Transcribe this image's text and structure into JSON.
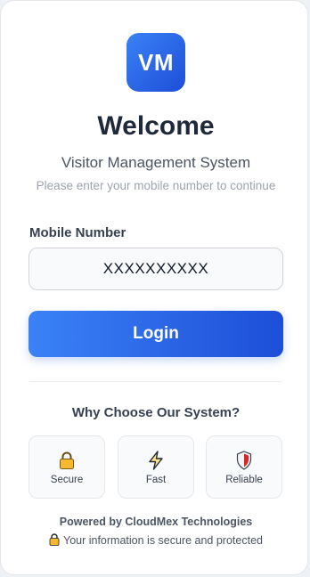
{
  "logo": {
    "text": "VM"
  },
  "header": {
    "title": "Welcome",
    "subtitle": "Visitor Management System",
    "hint": "Please enter your mobile number to continue"
  },
  "form": {
    "mobile_label": "Mobile Number",
    "mobile_value": "XXXXXXXXXX",
    "login_label": "Login"
  },
  "features": {
    "heading": "Why Choose Our System?",
    "items": [
      {
        "label": "Secure",
        "icon": "lock-icon"
      },
      {
        "label": "Fast",
        "icon": "lightning-icon"
      },
      {
        "label": "Reliable",
        "icon": "shield-icon"
      }
    ]
  },
  "footer": {
    "powered": "Powered by CloudMex Technologies",
    "secure_note": "Your information is secure and protected"
  },
  "colors": {
    "accent": "#2563eb",
    "accent_light": "#3b82f6",
    "title": "#1e293b"
  }
}
